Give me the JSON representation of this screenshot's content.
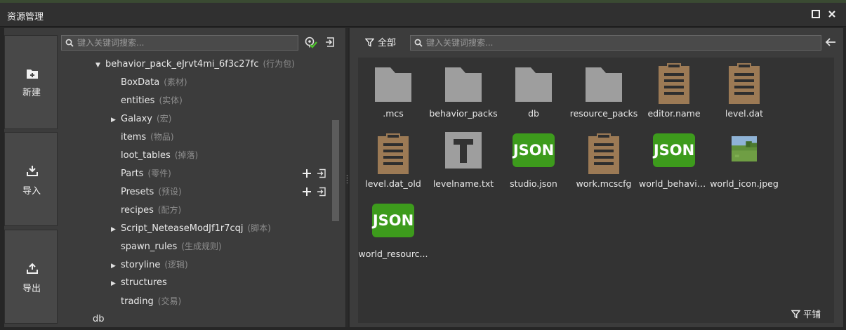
{
  "window": {
    "title": "资源管理"
  },
  "actions": [
    {
      "label": "新建",
      "icon": "new-folder-icon"
    },
    {
      "label": "导入",
      "icon": "import-icon"
    },
    {
      "label": "导出",
      "icon": "export-icon"
    }
  ],
  "left_search": {
    "placeholder": "键入关键词搜索..."
  },
  "tree": {
    "root": {
      "label": "behavior_pack_eJrvt4mi_6f3c27fc",
      "tag": "(行为包)",
      "expanded": true
    },
    "children": [
      {
        "label": "BoxData",
        "tag": "(素材)",
        "expandable": false
      },
      {
        "label": "entities",
        "tag": "(实体)",
        "expandable": false
      },
      {
        "label": "Galaxy",
        "tag": "(宏)",
        "expandable": true
      },
      {
        "label": "items",
        "tag": "(物品)",
        "expandable": false
      },
      {
        "label": "loot_tables",
        "tag": "(掉落)",
        "expandable": false
      },
      {
        "label": "Parts",
        "tag": "(零件)",
        "expandable": false,
        "row_actions": true
      },
      {
        "label": "Presets",
        "tag": "(预设)",
        "expandable": false,
        "row_actions": true
      },
      {
        "label": "recipes",
        "tag": "(配方)",
        "expandable": false
      },
      {
        "label": "Script_NeteaseModJf1r7cqj",
        "tag": "(脚本)",
        "expandable": true
      },
      {
        "label": "spawn_rules",
        "tag": "(生成规则)",
        "expandable": false
      },
      {
        "label": "storyline",
        "tag": "(逻辑)",
        "expandable": true
      },
      {
        "label": "structures",
        "tag": "",
        "expandable": true
      },
      {
        "label": "trading",
        "tag": "(交易)",
        "expandable": false
      }
    ],
    "sibling": {
      "label": "db",
      "tag": ""
    }
  },
  "right_toolbar": {
    "filter_label": "全部",
    "search_placeholder": "键入关键词搜索..."
  },
  "files": [
    {
      "name": ".mcs",
      "icon": "folder-icon"
    },
    {
      "name": "behavior_packs",
      "icon": "folder-icon"
    },
    {
      "name": "db",
      "icon": "folder-icon"
    },
    {
      "name": "resource_packs",
      "icon": "folder-icon"
    },
    {
      "name": "editor.name",
      "icon": "document-icon"
    },
    {
      "name": "level.dat",
      "icon": "document-icon"
    },
    {
      "name": "level.dat_old",
      "icon": "document-icon"
    },
    {
      "name": "levelname.txt",
      "icon": "text-file-icon"
    },
    {
      "name": "studio.json",
      "icon": "json-file-icon"
    },
    {
      "name": "work.mcscfg",
      "icon": "document-icon"
    },
    {
      "name": "world_behavio...",
      "icon": "json-file-icon"
    },
    {
      "name": "world_icon.jpeg",
      "icon": "image-thumbnail-icon"
    },
    {
      "name": "world_resourc...",
      "icon": "json-file-icon"
    }
  ],
  "json_icon_text": "JSON",
  "text_icon_letter": "T",
  "footer": {
    "flat_label": "平铺"
  },
  "colors": {
    "folder": "#9e9e9e",
    "document": "#9c7a55",
    "json": "#3d9b1c",
    "text_icon": "#9e9e9e",
    "accent_green": "#4cc22a"
  }
}
